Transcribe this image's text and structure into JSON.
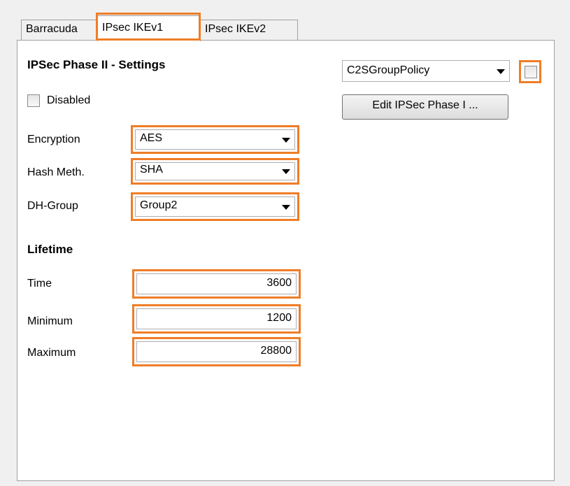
{
  "tabs": [
    "Barracuda",
    "IPsec IKEv1",
    "IPsec IKEv2"
  ],
  "active_tab": "IPsec IKEv1",
  "highlight_color": "#ef7d27",
  "settings": {
    "title": "IPSec Phase II - Settings",
    "disabled_label": "Disabled",
    "disabled_checked": false,
    "encryption_label": "Encryption",
    "encryption_value": "AES",
    "hash_label": "Hash Meth.",
    "hash_value": "SHA",
    "dh_label": "DH-Group",
    "dh_value": "Group2"
  },
  "lifetime": {
    "title": "Lifetime",
    "time_label": "Time",
    "time_value": "3600",
    "minimum_label": "Minimum",
    "minimum_value": "1200",
    "maximum_label": "Maximum",
    "maximum_value": "28800"
  },
  "policy": {
    "group_policy_value": "C2SGroupPolicy",
    "override_checked": false,
    "edit_button_label": "Edit IPSec Phase I ..."
  },
  "icons": {
    "dropdown": "chevron-down-icon"
  }
}
